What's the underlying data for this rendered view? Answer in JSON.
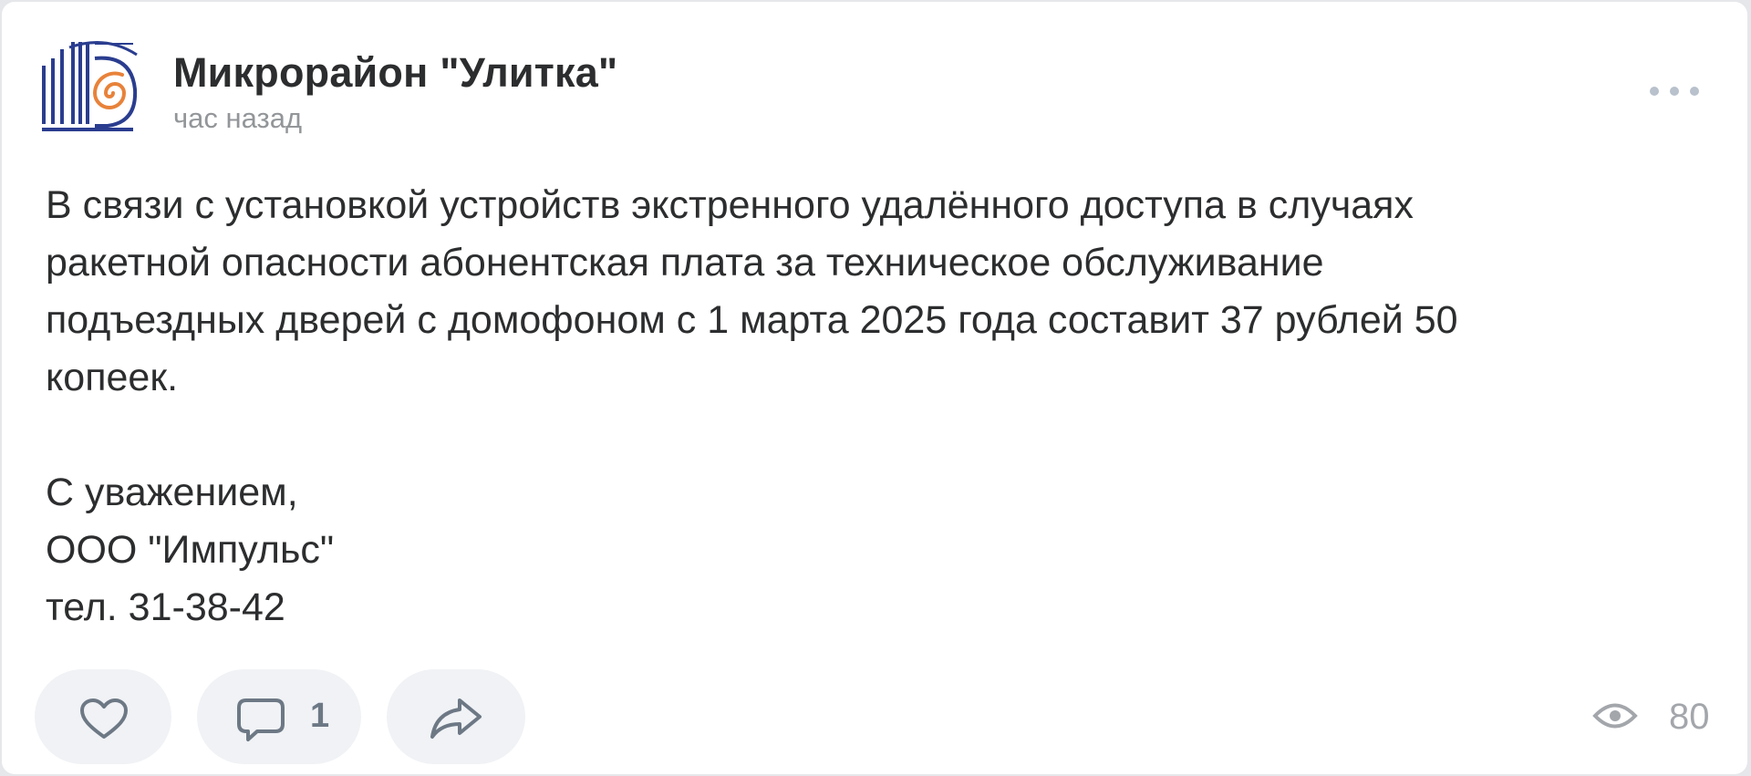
{
  "post": {
    "group_name": "Микрорайон \"Улитка\"",
    "time": "час назад",
    "text_lines": [
      "В связи с установкой устройств экстренного удалённого доступа в случаях",
      "ракетной опасности абонентская плата за техническое обслуживание",
      "подъездных дверей с домофоном с 1 марта 2025 года составит 37 рублей 50",
      "копеек."
    ],
    "signature_lines": [
      "С уважением,",
      "ООО \"Импульс\"",
      "тел. 31-38-42"
    ]
  },
  "actions": {
    "like_icon": "heart-icon",
    "comment_icon": "comment-icon",
    "comment_count": "1",
    "share_icon": "share-arrow-icon"
  },
  "stats": {
    "views_icon": "eye-icon",
    "views_count": "80"
  },
  "colors": {
    "text": "#2c2d2e",
    "secondary": "#939699",
    "icon": "#6d7885",
    "button_bg": "#f0f2f5",
    "logo_blue": "#2a3d8f",
    "logo_orange": "#e8823a"
  }
}
